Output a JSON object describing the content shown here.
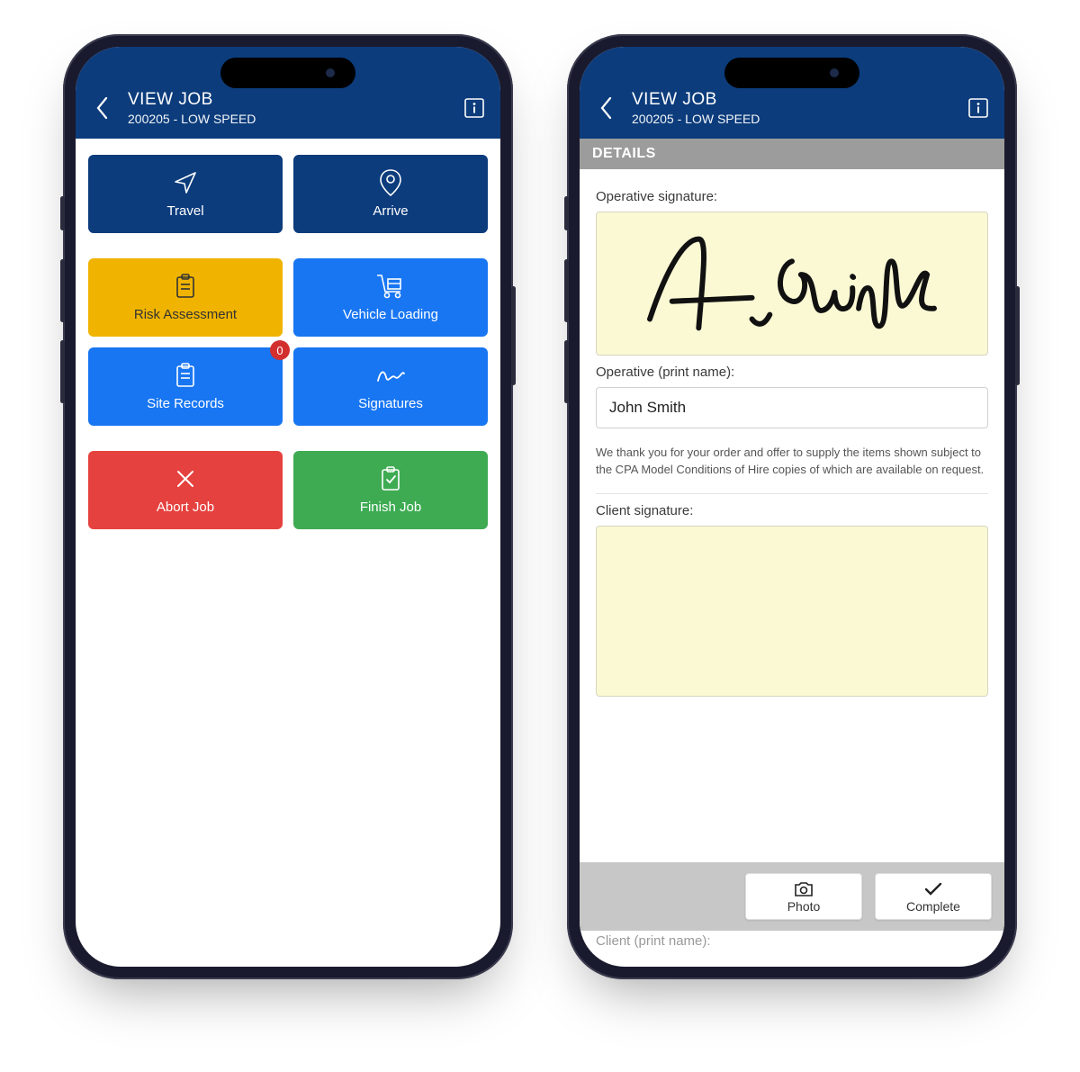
{
  "phone1": {
    "header": {
      "title": "VIEW JOB",
      "subtitle": "200205 - LOW SPEED"
    },
    "tiles": {
      "travel": "Travel",
      "arrive": "Arrive",
      "risk": "Risk Assessment",
      "vehicle": "Vehicle Loading",
      "site": "Site Records",
      "site_badge": "0",
      "signatures": "Signatures",
      "abort": "Abort Job",
      "finish": "Finish Job"
    }
  },
  "phone2": {
    "header": {
      "title": "VIEW JOB",
      "subtitle": "200205 - LOW SPEED"
    },
    "section": "DETAILS",
    "operative_sig_label": "Operative signature:",
    "operative_name_label": "Operative (print name):",
    "operative_name_value": "John Smith",
    "fineprint": "We thank you for your order and offer to supply the items shown subject to the CPA Model Conditions of Hire copies of which are available on request.",
    "client_sig_label": "Client signature:",
    "client_name_label": "Client (print name):",
    "buttons": {
      "photo": "Photo",
      "complete": "Complete"
    }
  }
}
